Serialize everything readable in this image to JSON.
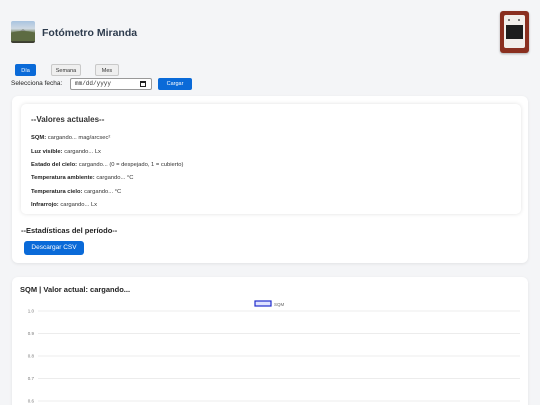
{
  "app": {
    "title": "Fotómetro Miranda"
  },
  "tabs": [
    {
      "label": "Día",
      "active": true
    },
    {
      "label": "Semana",
      "active": false
    },
    {
      "label": "Mes",
      "active": false
    }
  ],
  "date_selector": {
    "label": "Selecciona fecha:",
    "placeholder": "mm/dd/yyyy",
    "button_label": "Cargar"
  },
  "current_values": {
    "title": "--Valores actuales--",
    "rows": [
      {
        "name": "SQM:",
        "value": "cargando... mag/arcsec²"
      },
      {
        "name": "Luz visible:",
        "value": "cargando... Lx"
      },
      {
        "name": "Estado del cielo:",
        "value": "cargando... (0 = despejado, 1 = cubierto)"
      },
      {
        "name": "Temperatura ambiente:",
        "value": "cargando... °C"
      },
      {
        "name": "Temperatura cielo:",
        "value": "cargando... °C"
      },
      {
        "name": "Infrarrojo:",
        "value": "cargando... Lx"
      }
    ]
  },
  "stats": {
    "title": "--Estadísticas del período--",
    "csv_button": "Descargar CSV"
  },
  "chart_section": {
    "title": "SQM | Valor actual: cargando..."
  },
  "colors": {
    "accent": "#0a6ad8",
    "series": "#1f2ccc"
  },
  "chart_data": {
    "type": "line",
    "title": "",
    "xlabel": "",
    "ylabel": "",
    "series": [
      {
        "name": "SQM",
        "values": []
      }
    ],
    "y_ticks": [
      1.0,
      0.9,
      0.8,
      0.7,
      0.6
    ],
    "y_tick_labels": [
      "1.0",
      "0.9",
      "0.8",
      "0.7",
      "0.6"
    ],
    "ylim": [
      0.6,
      1.0
    ],
    "grid": true,
    "legend": "top-center"
  }
}
